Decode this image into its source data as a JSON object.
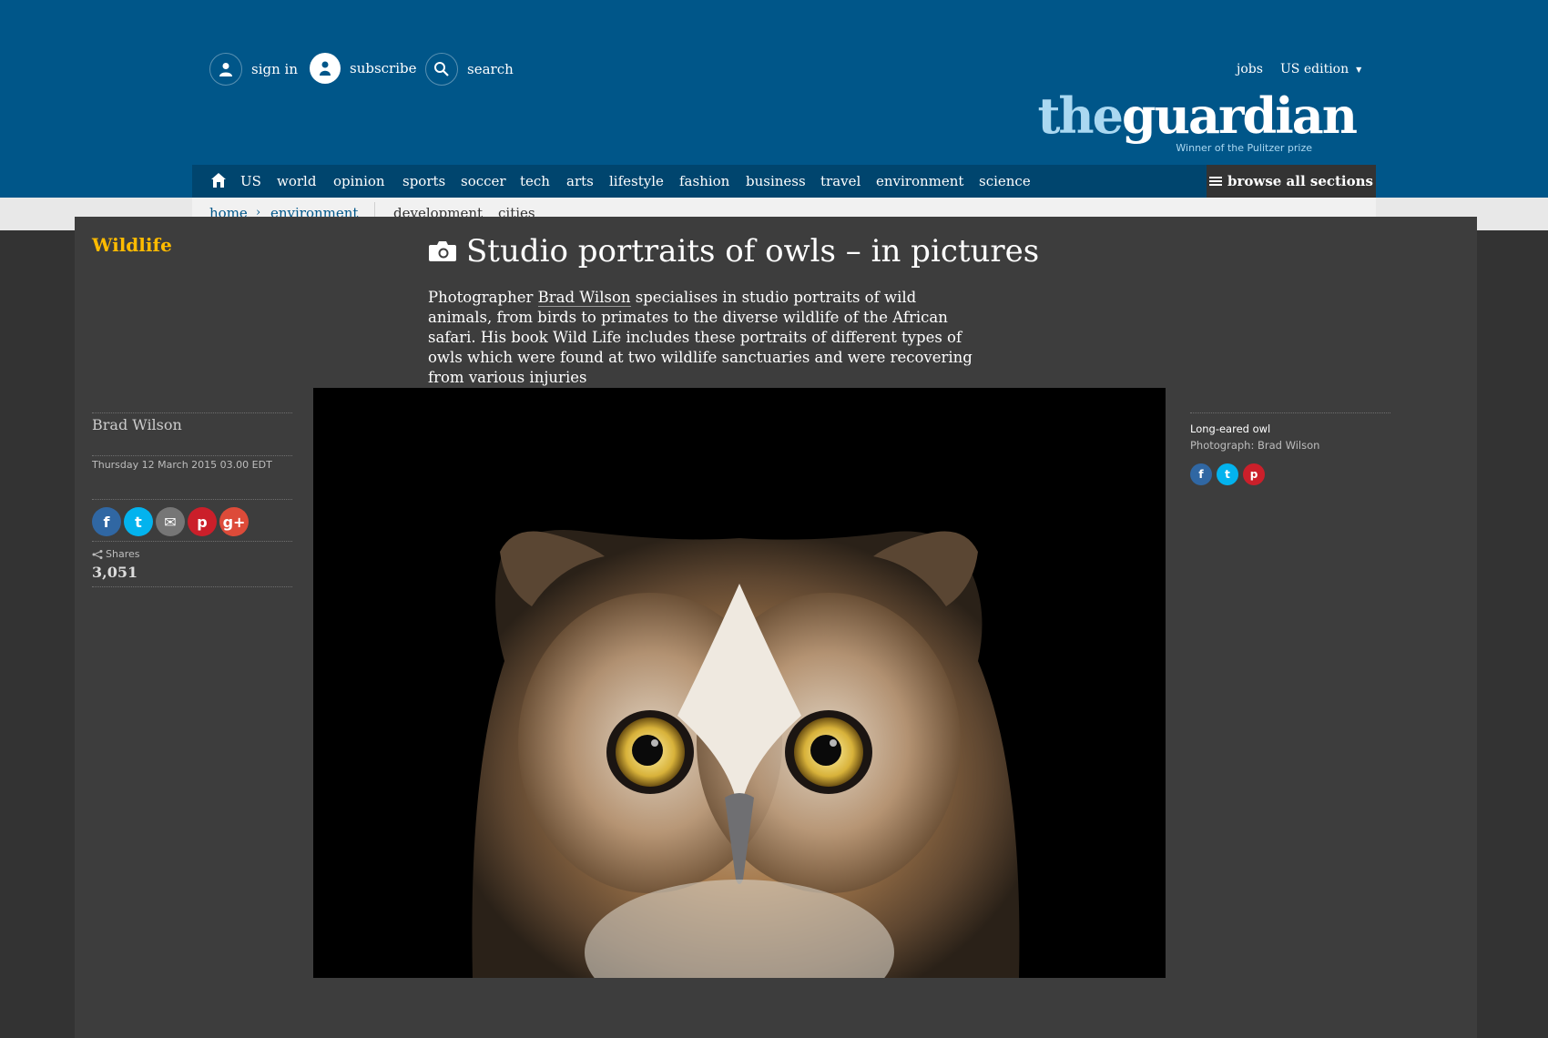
{
  "header": {
    "sign_in": "sign in",
    "subscribe": "subscribe",
    "search": "search",
    "jobs": "jobs",
    "edition": "US edition",
    "logo_the": "the",
    "logo_guardian": "guardian",
    "logo_sub": "Winner of the Pulitzer prize"
  },
  "nav": {
    "items": [
      "US",
      "world",
      "opinion",
      "sports",
      "soccer",
      "tech",
      "arts",
      "lifestyle",
      "fashion",
      "business",
      "travel",
      "environment",
      "science"
    ],
    "browse": "browse all sections"
  },
  "subnav": {
    "crumbs": [
      "home",
      "environment"
    ],
    "separator": "›",
    "related": [
      "development",
      "cities"
    ]
  },
  "article": {
    "kicker": "Wildlife",
    "title": "Studio portraits of owls – in pictures",
    "standfirst_before": "Photographer ",
    "standfirst_link": "Brad Wilson",
    "standfirst_after": " specialises in studio portraits of wild animals, from birds to primates to the diverse wildlife of the African safari. His book Wild Life includes these portraits of different types of owls which were found at two wildlife sanctuaries and were recovering from various injuries",
    "byline": "Brad Wilson",
    "date": "Thursday 12 March 2015 03.00 EDT",
    "shares_label": "Shares",
    "shares_count": "3,051"
  },
  "share_buttons": [
    {
      "name": "facebook-icon",
      "glyph": "f",
      "color": "#3067a3"
    },
    {
      "name": "twitter-icon",
      "glyph": "t",
      "color": "#03b3ee"
    },
    {
      "name": "email-icon",
      "glyph": "✉",
      "color": "#767676"
    },
    {
      "name": "pinterest-icon",
      "glyph": "p",
      "color": "#cb1f2a"
    },
    {
      "name": "googleplus-icon",
      "glyph": "g+",
      "color": "#dd4b39"
    }
  ],
  "caption": {
    "title": "Long-eared owl",
    "credit": "Photograph: Brad Wilson"
  },
  "colors": {
    "brand_blue": "#005689",
    "nav_dark": "#00456e",
    "kicker_yellow": "#ffbb00",
    "background": "#333333"
  }
}
